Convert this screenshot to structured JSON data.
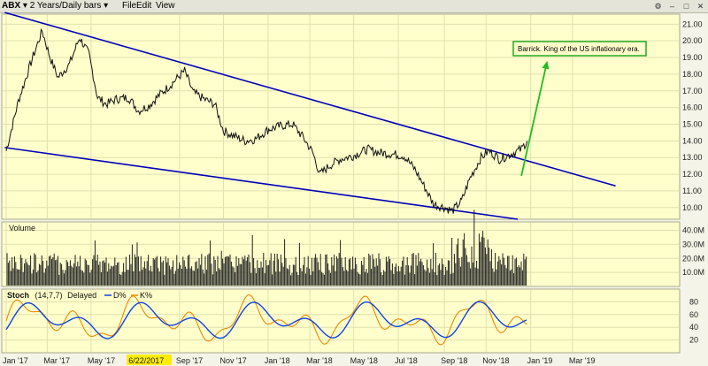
{
  "toolbar": {
    "symbol": "ABX",
    "range": "2 Years/Daily bars",
    "menu_file": "File",
    "menu_edit": "Edit",
    "menu_view": "View"
  },
  "chart_data": {
    "type": "line",
    "symbol": "ABX",
    "xlabels": [
      "Jan '17",
      "Mar '17",
      "May '17",
      "6/22/2017",
      "Sep '17",
      "Nov '17",
      "Jan '18",
      "Mar '18",
      "May '18",
      "Jul '18",
      "Sep '18",
      "Nov '18",
      "Jan '19",
      "Mar '19"
    ],
    "price": {
      "ylim": [
        9.3,
        21.6
      ],
      "yticks": [
        "10.00",
        "11.00",
        "12.00",
        "13.00",
        "14.00",
        "15.00",
        "16.00",
        "17.00",
        "18.00",
        "19.00",
        "20.00",
        "21.00"
      ],
      "points": [
        [
          "2017-01-03",
          13.4
        ],
        [
          "2017-01-20",
          16.4
        ],
        [
          "2017-02-08",
          18.9
        ],
        [
          "2017-02-22",
          20.6
        ],
        [
          "2017-03-05",
          19.0
        ],
        [
          "2017-03-16",
          17.8
        ],
        [
          "2017-04-01",
          18.6
        ],
        [
          "2017-04-15",
          20.2
        ],
        [
          "2017-04-28",
          19.2
        ],
        [
          "2017-05-10",
          16.6
        ],
        [
          "2017-05-22",
          16.2
        ],
        [
          "2017-06-05",
          16.5
        ],
        [
          "2017-06-22",
          16.6
        ],
        [
          "2017-07-06",
          15.8
        ],
        [
          "2017-07-20",
          16.1
        ],
        [
          "2017-08-05",
          16.8
        ],
        [
          "2017-08-18",
          17.3
        ],
        [
          "2017-09-08",
          18.2
        ],
        [
          "2017-09-20",
          16.9
        ],
        [
          "2017-10-05",
          16.5
        ],
        [
          "2017-10-20",
          16.2
        ],
        [
          "2017-11-01",
          14.6
        ],
        [
          "2017-11-15",
          14.3
        ],
        [
          "2017-12-01",
          14.0
        ],
        [
          "2017-12-15",
          14.1
        ],
        [
          "2018-01-03",
          14.7
        ],
        [
          "2018-01-20",
          14.9
        ],
        [
          "2018-02-05",
          15.0
        ],
        [
          "2018-02-20",
          14.2
        ],
        [
          "2018-03-05",
          13.3
        ],
        [
          "2018-03-15",
          12.0
        ],
        [
          "2018-03-28",
          12.5
        ],
        [
          "2018-04-12",
          12.9
        ],
        [
          "2018-04-30",
          13.1
        ],
        [
          "2018-05-20",
          13.5
        ],
        [
          "2018-06-05",
          13.3
        ],
        [
          "2018-06-25",
          13.2
        ],
        [
          "2018-07-10",
          13.1
        ],
        [
          "2018-07-25",
          12.3
        ],
        [
          "2018-08-08",
          11.2
        ],
        [
          "2018-08-20",
          10.2
        ],
        [
          "2018-09-05",
          10.0
        ],
        [
          "2018-09-15",
          9.8
        ],
        [
          "2018-09-28",
          10.4
        ],
        [
          "2018-10-10",
          11.8
        ],
        [
          "2018-10-25",
          13.0
        ],
        [
          "2018-11-05",
          13.4
        ],
        [
          "2018-11-20",
          12.9
        ],
        [
          "2018-12-05",
          13.2
        ],
        [
          "2018-12-20",
          13.5
        ],
        [
          "2018-12-28",
          14.0
        ]
      ],
      "trend_lines": [
        {
          "from": [
            "2017-01-01",
            21.7
          ],
          "to": [
            "2019-04-30",
            11.3
          ],
          "color": "#0000bb"
        },
        {
          "from": [
            "2017-01-01",
            13.6
          ],
          "to": [
            "2018-12-15",
            9.3
          ],
          "color": "#0000bb"
        }
      ],
      "arrow": {
        "from": [
          "2018-12-20",
          11.9
        ],
        "to": [
          "2019-01-25",
          18.8
        ],
        "color": "#22bb22"
      },
      "annotation": "Barrick.  King of the US inflationary era."
    },
    "volume": {
      "label": "Volume",
      "ylim": [
        0,
        46000000
      ],
      "yticks": [
        "10.0M",
        "20.0M",
        "30.0M",
        "40.0M"
      ]
    },
    "stoch": {
      "label": "Stoch",
      "params": "(14,7,7)",
      "note": "Delayed",
      "series": [
        {
          "name": "D%",
          "color": "#1144dd"
        },
        {
          "name": "K%",
          "color": "#ee8800"
        }
      ],
      "ylim": [
        0,
        100
      ],
      "yticks": [
        "20",
        "40",
        "60",
        "80"
      ]
    }
  }
}
